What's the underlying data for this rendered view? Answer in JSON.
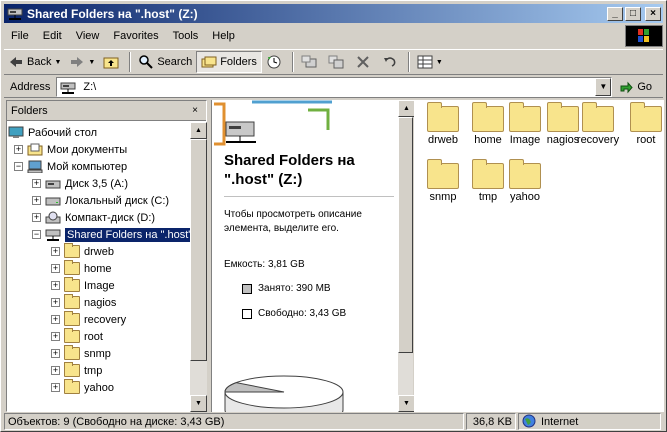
{
  "window": {
    "title": "Shared Folders на \".host\" (Z:)"
  },
  "title_buttons": {
    "minimize": "_",
    "maximize": "□",
    "close": "×"
  },
  "menu": [
    "File",
    "Edit",
    "View",
    "Favorites",
    "Tools",
    "Help"
  ],
  "toolbar": {
    "back": "Back",
    "search": "Search",
    "folders": "Folders"
  },
  "address": {
    "label": "Address",
    "value": "Z:\\",
    "go": "Go"
  },
  "folders_pane": {
    "header": "Folders",
    "close": "×"
  },
  "tree": [
    {
      "label": "Рабочий стол",
      "icon": "desktop-icon",
      "expander": ""
    },
    {
      "label": "Мои документы",
      "icon": "my-documents-icon",
      "expander": "+"
    },
    {
      "label": "Мой компьютер",
      "icon": "my-computer-icon",
      "expander": "−"
    },
    {
      "label": "Диск 3,5 (A:)",
      "icon": "floppy-icon",
      "expander": "+"
    },
    {
      "label": "Локальный диск (C:)",
      "icon": "hard-drive-icon",
      "expander": "+"
    },
    {
      "label": "Компакт-диск (D:)",
      "icon": "cd-drive-icon",
      "expander": "+"
    },
    {
      "label": "Shared Folders на \".host\"",
      "icon": "network-drive-icon",
      "expander": "−",
      "selected": true
    },
    {
      "label": "drweb",
      "icon": "folder-icon",
      "expander": "+"
    },
    {
      "label": "home",
      "icon": "folder-icon",
      "expander": "+"
    },
    {
      "label": "Image",
      "icon": "folder-icon",
      "expander": "+"
    },
    {
      "label": "nagios",
      "icon": "folder-icon",
      "expander": "+"
    },
    {
      "label": "recovery",
      "icon": "folder-icon",
      "expander": "+"
    },
    {
      "label": "root",
      "icon": "folder-icon",
      "expander": "+"
    },
    {
      "label": "snmp",
      "icon": "folder-icon",
      "expander": "+"
    },
    {
      "label": "tmp",
      "icon": "folder-icon",
      "expander": "+"
    },
    {
      "label": "yahoo",
      "icon": "folder-icon",
      "expander": "+"
    }
  ],
  "info": {
    "title": "Shared Folders на \".host\" (Z:)",
    "description": "Чтобы просмотреть описание элемента, выделите его.",
    "capacity": "Емкость: 3,81 GB",
    "used": "Занято: 390 MB",
    "free": "Свободно: 3,43 GB",
    "used_fraction": 0.1
  },
  "files": [
    "drweb",
    "home",
    "Image",
    "nagios",
    "recovery",
    "root",
    "snmp",
    "tmp",
    "yahoo"
  ],
  "status": {
    "objects": "Объектов: 9 (Свободно на диске: 3,43 GB)",
    "size": "36,8 KB",
    "zone": "Internet"
  },
  "colors": {
    "title_start": "#0a246a",
    "title_end": "#a6caf0",
    "selection": "#0a246a",
    "folder": "#f8e48c"
  }
}
